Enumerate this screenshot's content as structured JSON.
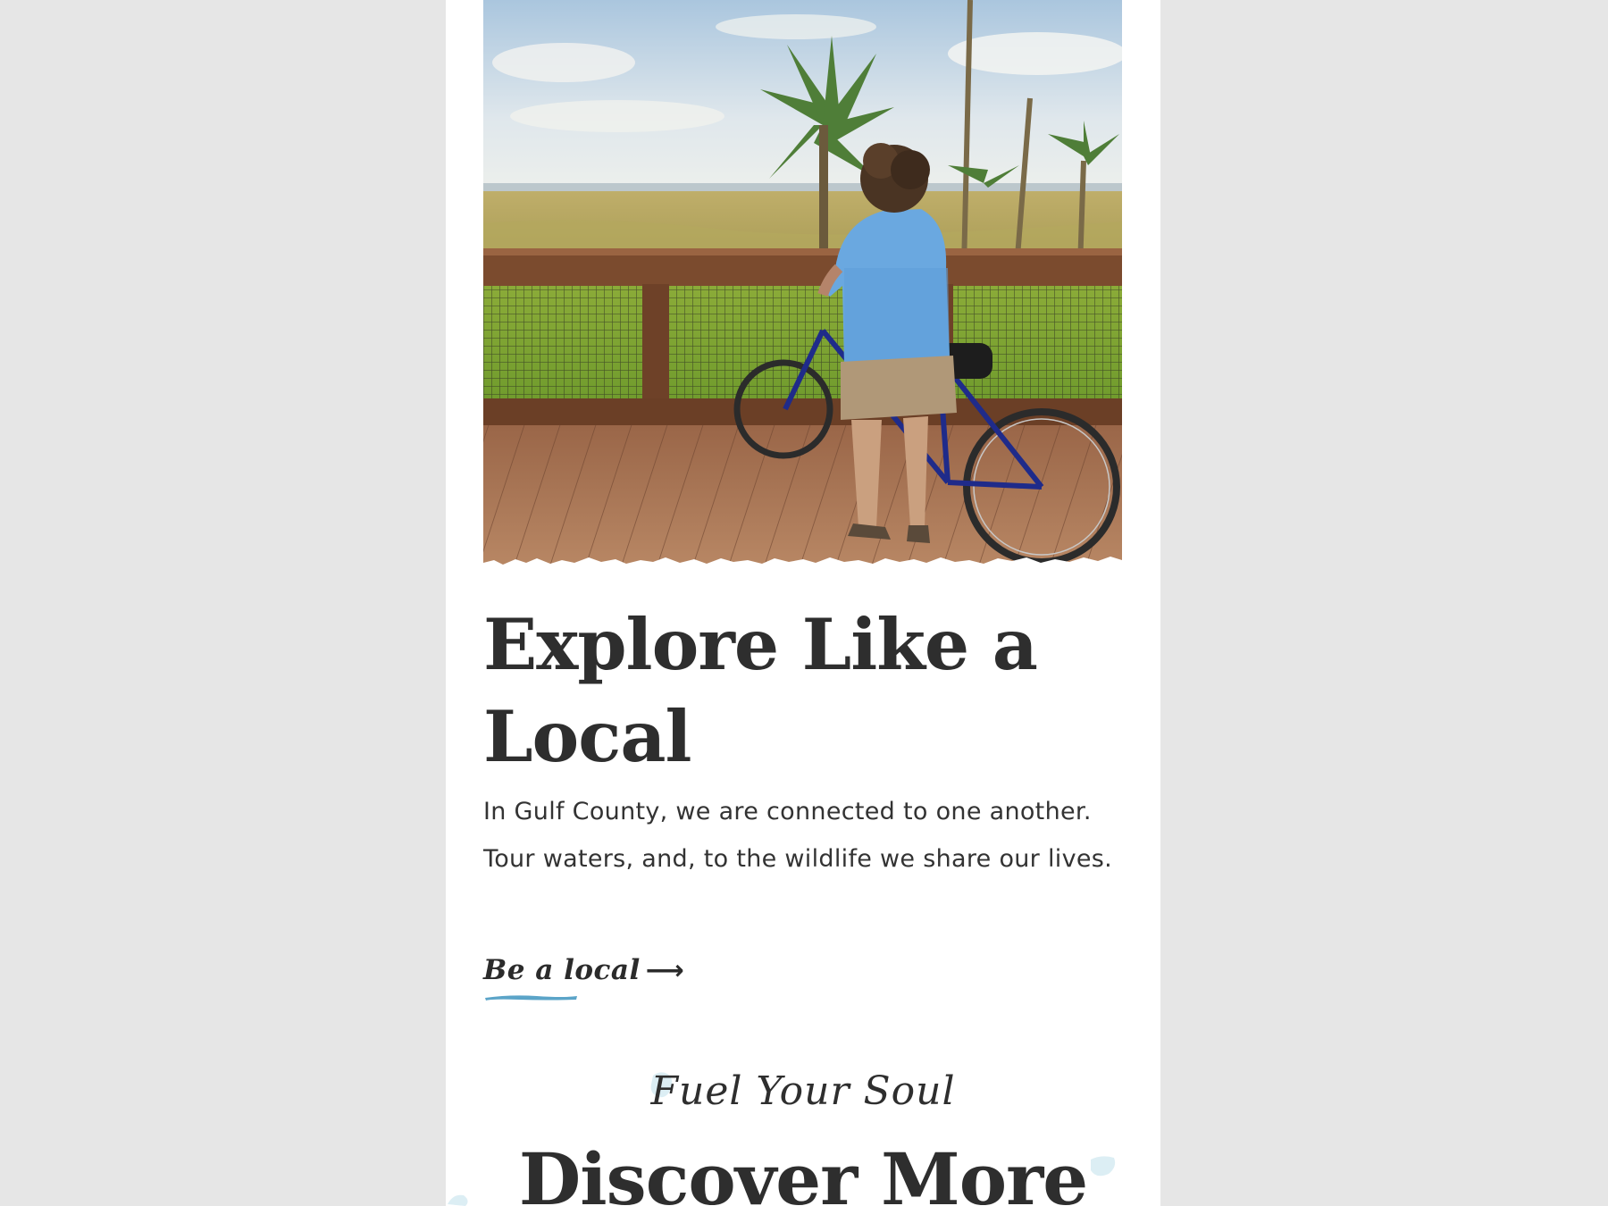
{
  "hero": {
    "image_label": "Woman with a blue bicycle on a wooden boardwalk overlooking palms and marsh"
  },
  "feature": {
    "headline_line1": "Explore Like a",
    "headline_line2": "Local",
    "body": "In Gulf County, we are connected to one another. Tour waters, and, to the wildlife we share our lives.",
    "cta_label": "Be a local",
    "cta_arrow": "⟶"
  },
  "next_section": {
    "eyebrow": "Fuel Your Soul",
    "title": "Discover More"
  },
  "colors": {
    "page_bg": "#e6e6e6",
    "card_bg": "#ffffff",
    "text": "#2e2e2e",
    "accent": "#5ba4c8",
    "splash": "#dceef4"
  }
}
